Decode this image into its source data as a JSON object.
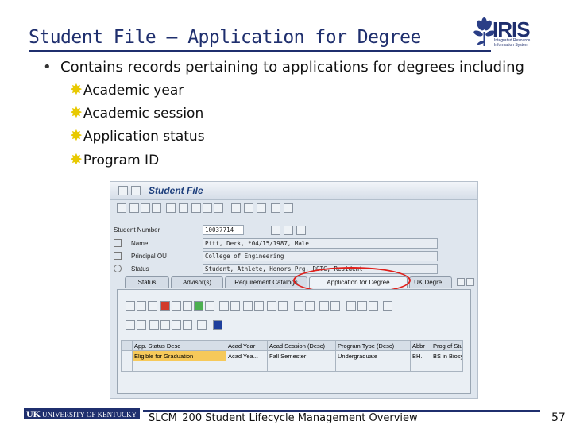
{
  "slide": {
    "title": "Student File – Application for Degree",
    "bullet": "Contains records pertaining to applications for degrees including",
    "sub_bullets": [
      "Academic year",
      "Academic session",
      "Application status",
      "Program ID"
    ]
  },
  "logo": {
    "name": "IRIS",
    "sub": "Integrated Resource Information System"
  },
  "sap": {
    "window_title": "Student File",
    "fields": {
      "student_number_label": "Student Number",
      "student_number_value": "10037714",
      "name_label": "Name",
      "name_value": "Pitt, Derk, *04/15/1987, Male",
      "principal_ou_label": "Principal OU",
      "principal_ou_value": "College of Engineering",
      "status_label": "Status",
      "status_value": "Student, Athlete, Honors Prg, ROTC, Resident"
    },
    "tabs": [
      "Status",
      "Advisor(s)",
      "Requirement Catalogs",
      "Application for Degree",
      "UK Degre..."
    ],
    "active_tab": "Application for Degree",
    "grid": {
      "headers": [
        "App. Status Desc",
        "Acad Year",
        "Acad Session (Desc)",
        "Program Type (Desc)",
        "Abbr",
        "Prog of Study"
      ],
      "rows": [
        [
          "Eligible for Graduation",
          "Acad Yea...",
          "Fall Semester",
          "Undergraduate",
          "BH..",
          "BS in Biosysto"
        ]
      ]
    }
  },
  "footer": {
    "university": "UNIVERSITY OF KENTUCKY",
    "uk": "UK",
    "text": "SLCM_200 Student Lifecycle Management Overview",
    "page": "57"
  }
}
